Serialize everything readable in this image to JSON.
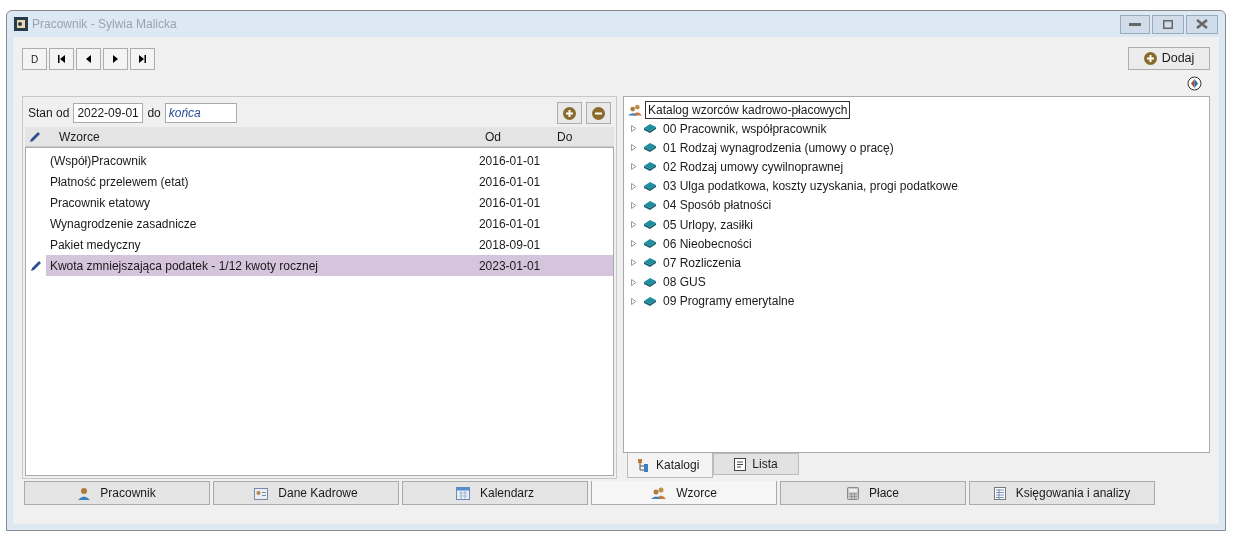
{
  "window": {
    "title": "Pracownik - Sylwia Malicka"
  },
  "toolbar": {
    "nav_buttons": [
      {
        "kind": "text",
        "label": "D"
      },
      {
        "kind": "first"
      },
      {
        "kind": "prev"
      },
      {
        "kind": "next"
      },
      {
        "kind": "last"
      }
    ],
    "add_button": "Dodaj"
  },
  "filter": {
    "from_label": "Stan od",
    "from_value": "2022-09-01",
    "to_label": "do",
    "to_value": "końca"
  },
  "table": {
    "columns": [
      "Wzorce",
      "Od",
      "Do"
    ],
    "rows": [
      {
        "name": "(Współ)Pracownik",
        "od": "2016-01-01",
        "selected": false
      },
      {
        "name": "Płatność przelewem (etat)",
        "od": "2016-01-01",
        "selected": false
      },
      {
        "name": "Pracownik etatowy",
        "od": "2016-01-01",
        "selected": false
      },
      {
        "name": "Wynagrodzenie zasadnicze",
        "od": "2016-01-01",
        "selected": false
      },
      {
        "name": "Pakiet medyczny",
        "od": "2018-09-01",
        "selected": false
      },
      {
        "name": "Kwota zmniejszająca podatek - 1/12 kwoty rocznej",
        "od": "2023-01-01",
        "selected": true
      }
    ]
  },
  "tree": {
    "root": "Katalog wzorców kadrowo-płacowych",
    "children": [
      {
        "label": "00 Pracownik, współpracownik",
        "expanded": false
      },
      {
        "label": "01 Rodzaj wynagrodzenia (umowy o pracę)",
        "expanded": false
      },
      {
        "label": "02 Rodzaj umowy cywilnoprawnej",
        "expanded": false
      },
      {
        "label": "03 Ulga podatkowa, koszty uzyskania, progi podatkowe",
        "expanded": false
      },
      {
        "label": "04 Sposób płatności",
        "expanded": false
      },
      {
        "label": "05 Urlopy, zasiłki",
        "expanded": false
      },
      {
        "label": "06 Nieobecności",
        "expanded": false
      },
      {
        "label": "07 Rozliczenia",
        "expanded": false
      },
      {
        "label": "08 GUS",
        "expanded": false
      },
      {
        "label": "09 Programy emerytalne",
        "expanded": false
      }
    ]
  },
  "sub_tabs": [
    {
      "label": "Katalogi",
      "kind": "tree",
      "selected": true
    },
    {
      "label": "Lista",
      "kind": "list",
      "selected": false
    }
  ],
  "bottom_tabs": [
    {
      "label": "Pracownik",
      "kind": "person",
      "selected": false
    },
    {
      "label": "Dane Kadrowe",
      "kind": "card",
      "selected": false
    },
    {
      "label": "Kalendarz",
      "kind": "calendar",
      "selected": false
    },
    {
      "label": "Wzorce",
      "kind": "people",
      "selected": true
    },
    {
      "label": "Płace",
      "kind": "calculator",
      "selected": false
    },
    {
      "label": "Księgowania i analizy",
      "kind": "sheet",
      "selected": false
    }
  ]
}
